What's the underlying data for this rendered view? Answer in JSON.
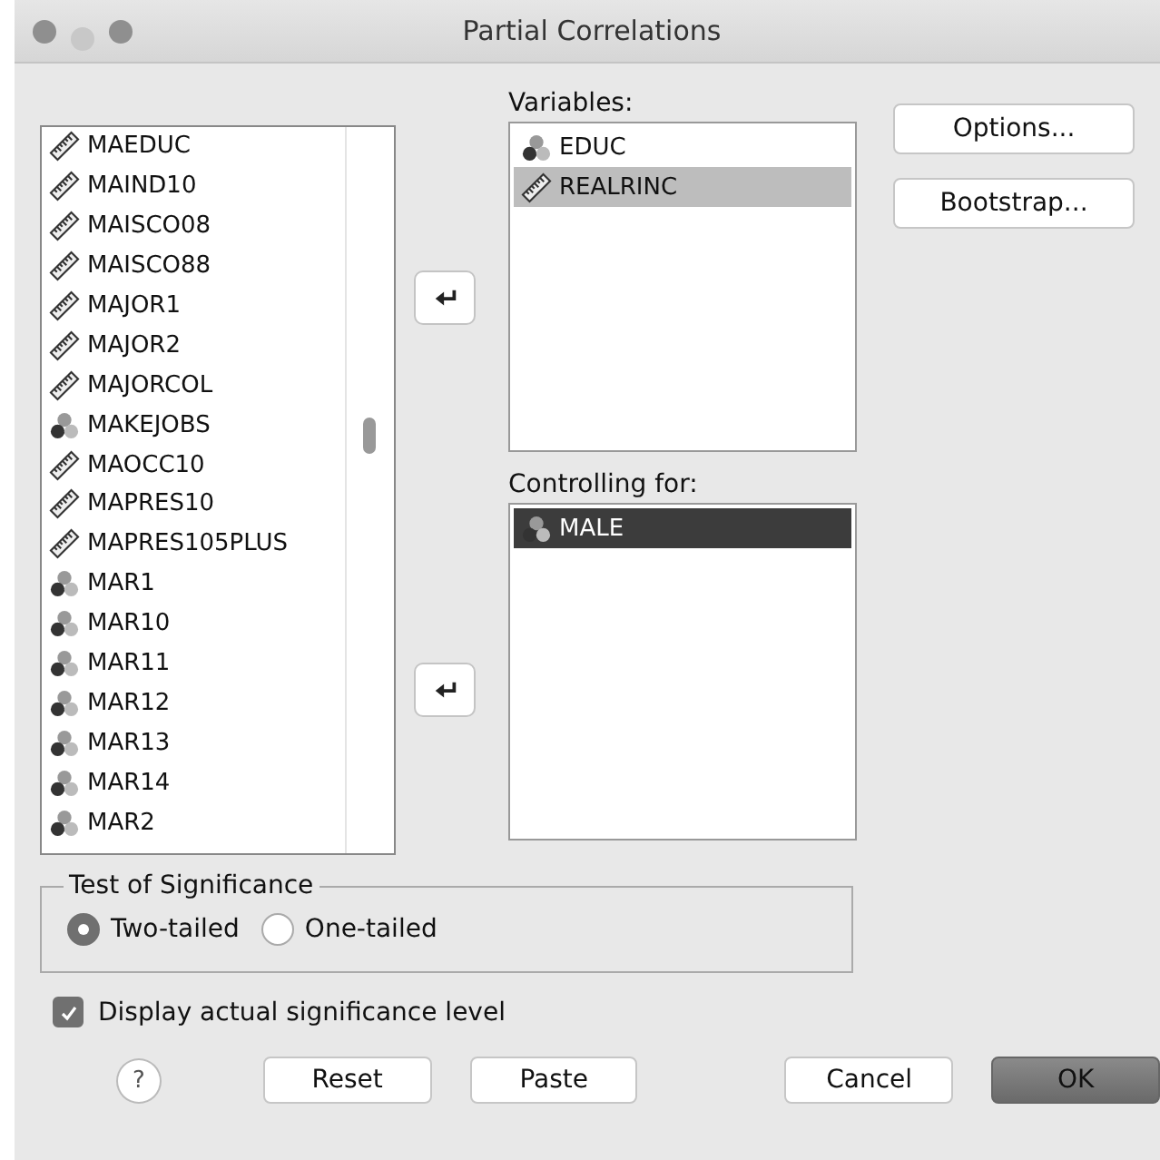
{
  "window": {
    "title": "Partial Correlations"
  },
  "source_list": {
    "items": [
      {
        "name": "MAEDUC",
        "kind": "scale"
      },
      {
        "name": "MAIND10",
        "kind": "scale"
      },
      {
        "name": "MAISCO08",
        "kind": "scale"
      },
      {
        "name": "MAISCO88",
        "kind": "scale"
      },
      {
        "name": "MAJOR1",
        "kind": "scale"
      },
      {
        "name": "MAJOR2",
        "kind": "scale"
      },
      {
        "name": "MAJORCOL",
        "kind": "scale"
      },
      {
        "name": "MAKEJOBS",
        "kind": "nominal"
      },
      {
        "name": "MAOCC10",
        "kind": "scale"
      },
      {
        "name": "MAPRES10",
        "kind": "scale"
      },
      {
        "name": "MAPRES105PLUS",
        "kind": "scale"
      },
      {
        "name": "MAR1",
        "kind": "nominal"
      },
      {
        "name": "MAR10",
        "kind": "nominal"
      },
      {
        "name": "MAR11",
        "kind": "nominal"
      },
      {
        "name": "MAR12",
        "kind": "nominal"
      },
      {
        "name": "MAR13",
        "kind": "nominal"
      },
      {
        "name": "MAR14",
        "kind": "nominal"
      },
      {
        "name": "MAR2",
        "kind": "nominal"
      }
    ]
  },
  "variables": {
    "label": "Variables:",
    "focused": false,
    "items": [
      {
        "name": "EDUC",
        "kind": "nominal",
        "selected": false
      },
      {
        "name": "REALRINC",
        "kind": "scale",
        "selected": true
      }
    ]
  },
  "controlling": {
    "label": "Controlling for:",
    "focused": true,
    "items": [
      {
        "name": "MALE",
        "kind": "nominal",
        "selected": true
      }
    ]
  },
  "side_buttons": [
    "Options...",
    "Bootstrap..."
  ],
  "significance": {
    "title": "Test of Significance",
    "options": [
      {
        "label": "Two-tailed",
        "selected": true
      },
      {
        "label": "One-tailed",
        "selected": false
      }
    ]
  },
  "display_level": {
    "label": "Display actual significance level",
    "checked": true
  },
  "buttons": [
    {
      "label": "?",
      "kind": "help"
    },
    {
      "label": "Reset",
      "kind": "normal"
    },
    {
      "label": "Paste",
      "kind": "normal"
    },
    {
      "label": "Cancel",
      "kind": "normal"
    },
    {
      "label": "OK",
      "kind": "default"
    }
  ]
}
